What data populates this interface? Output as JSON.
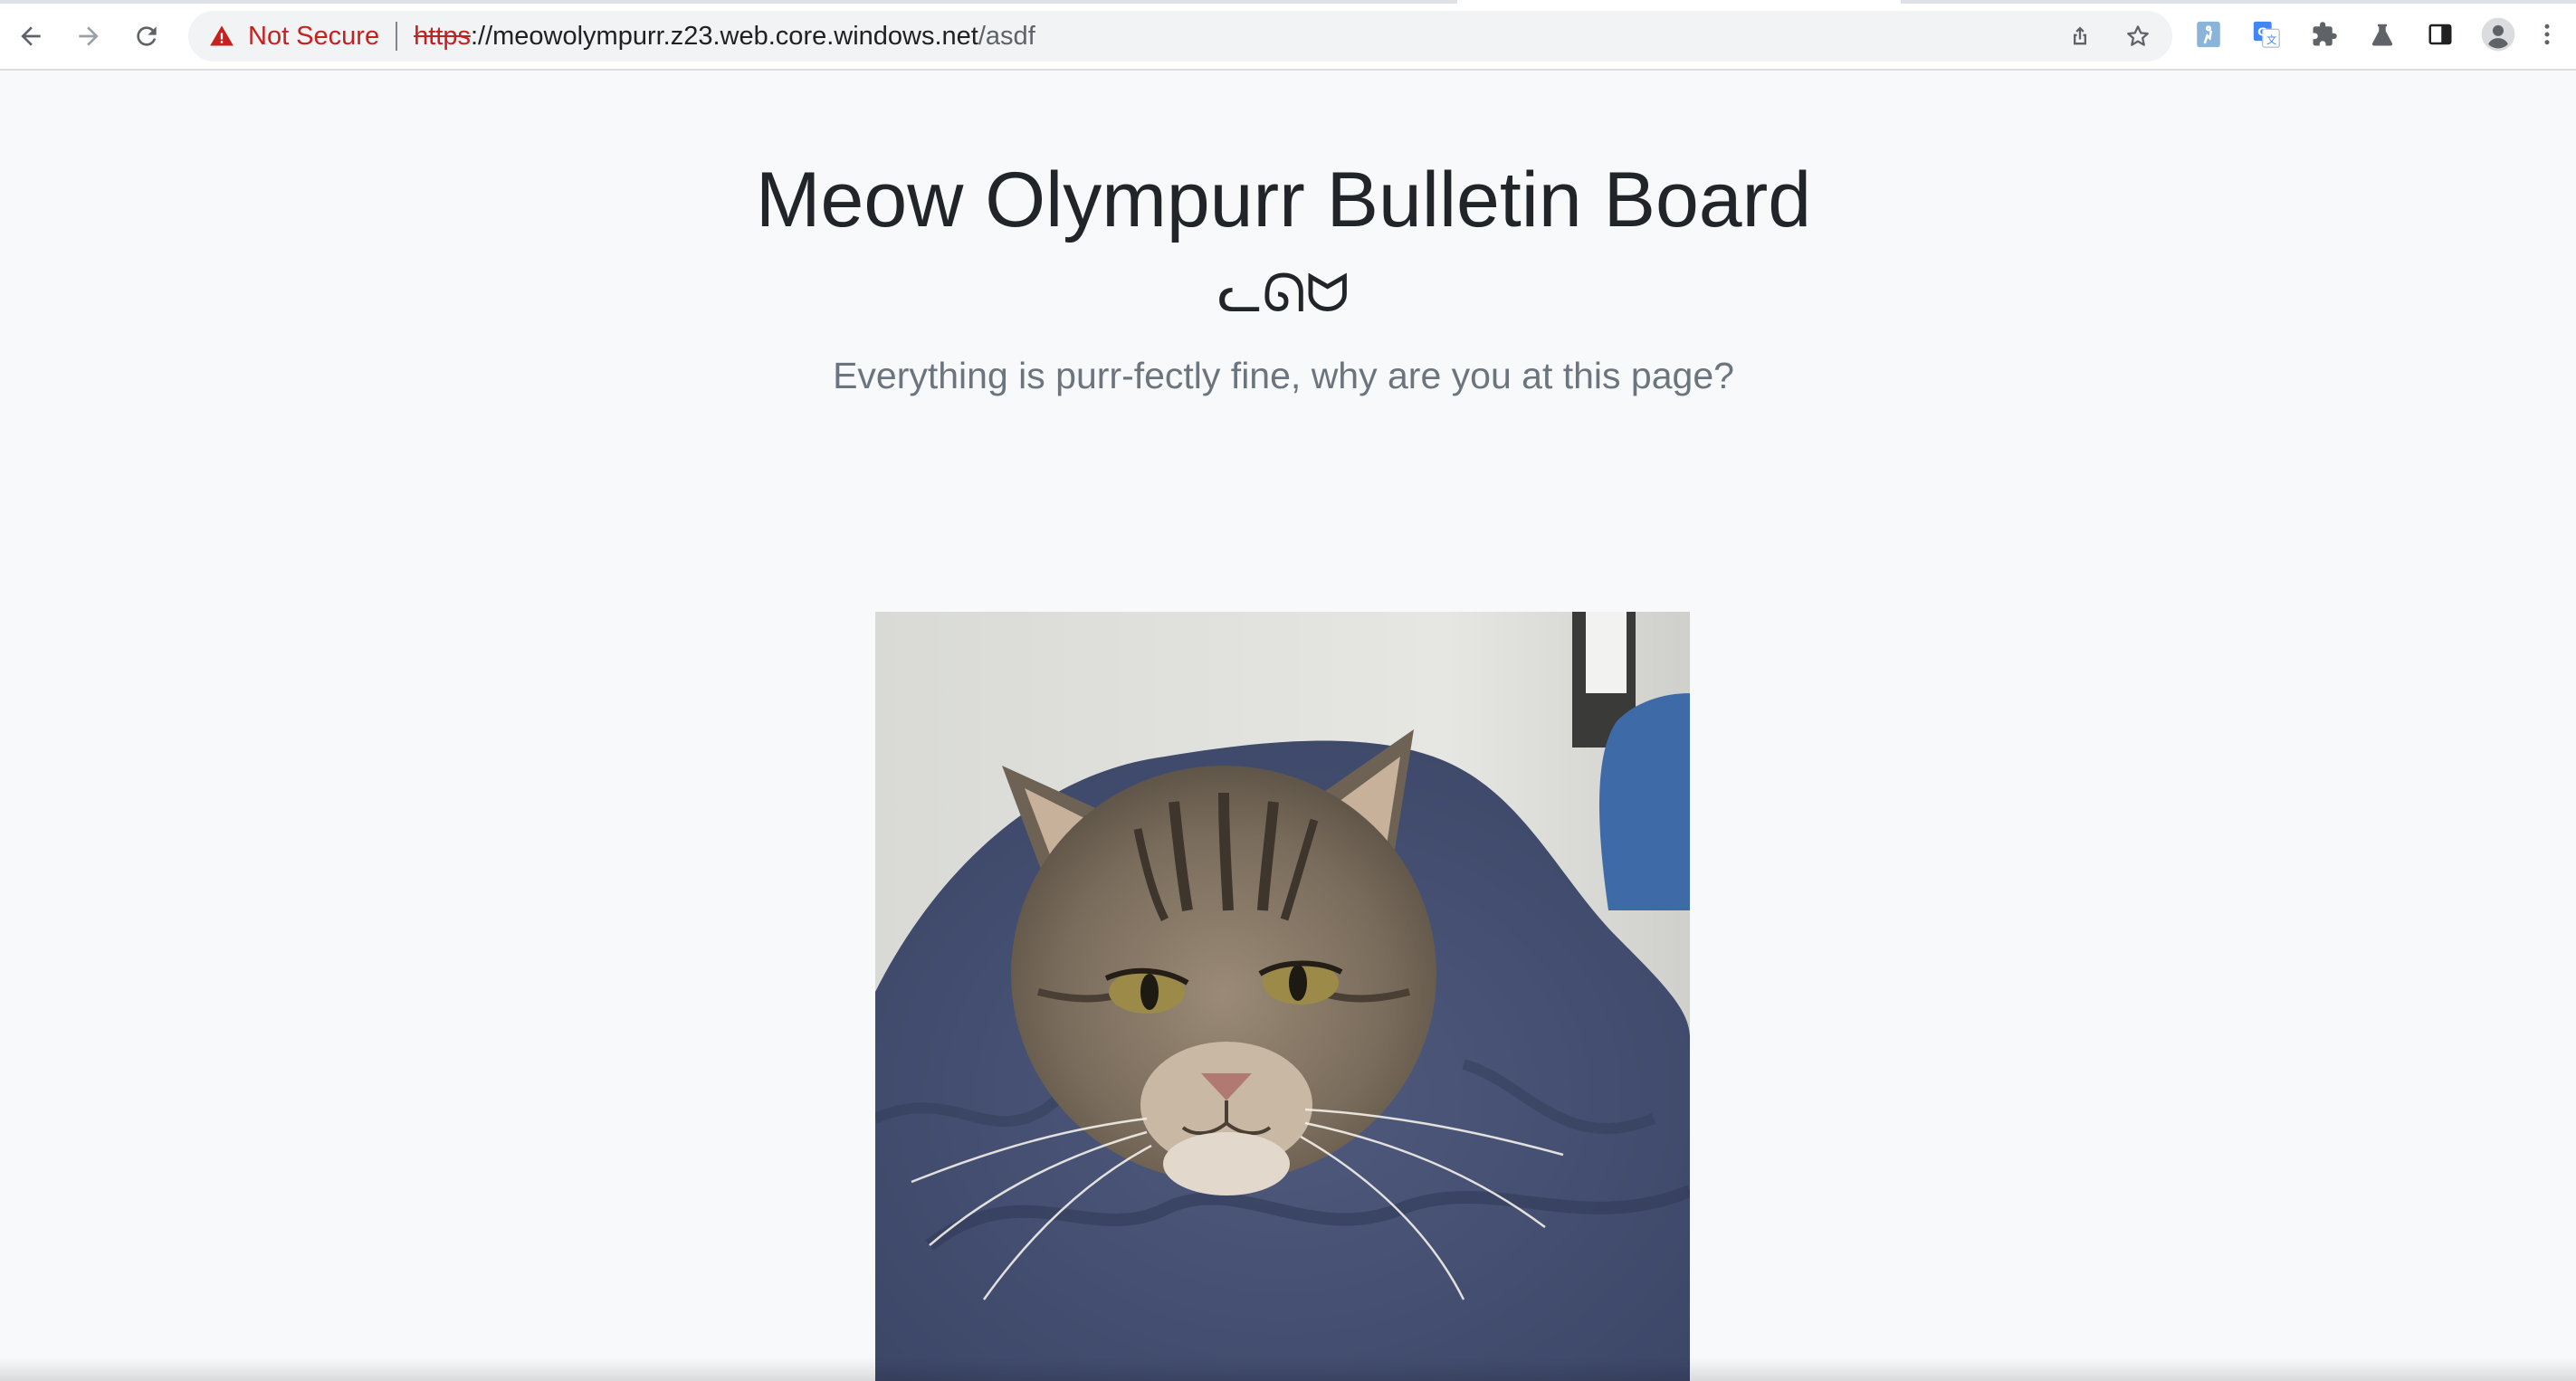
{
  "browser": {
    "security_label": "Not Secure",
    "url_scheme": "https",
    "url_separator": "://",
    "url_host": "meowolympurr.z23.web.core.windows.net",
    "url_path": "/asdf",
    "icons": {
      "back": "back-arrow-icon",
      "forward": "forward-arrow-icon",
      "reload": "reload-icon",
      "warning": "warning-triangle-icon",
      "share": "share-icon",
      "bookmark": "star-icon",
      "extension_1": "extension-icon",
      "translate": "translate-icon",
      "extensions": "puzzle-icon",
      "labs": "flask-icon",
      "side_panel": "side-panel-icon",
      "profile": "profile-avatar-icon",
      "menu": "kebab-menu-icon"
    },
    "colors": {
      "warning": "#c5221f",
      "omnibox_bg": "#f1f3f4"
    }
  },
  "page": {
    "title": "Meow Olympurr Bulletin Board",
    "kaomoji": "ᓚᘏᗢ",
    "subtitle": "Everything is purr-fectly fine, why are you at this page?",
    "background": "#f8f9fa"
  }
}
